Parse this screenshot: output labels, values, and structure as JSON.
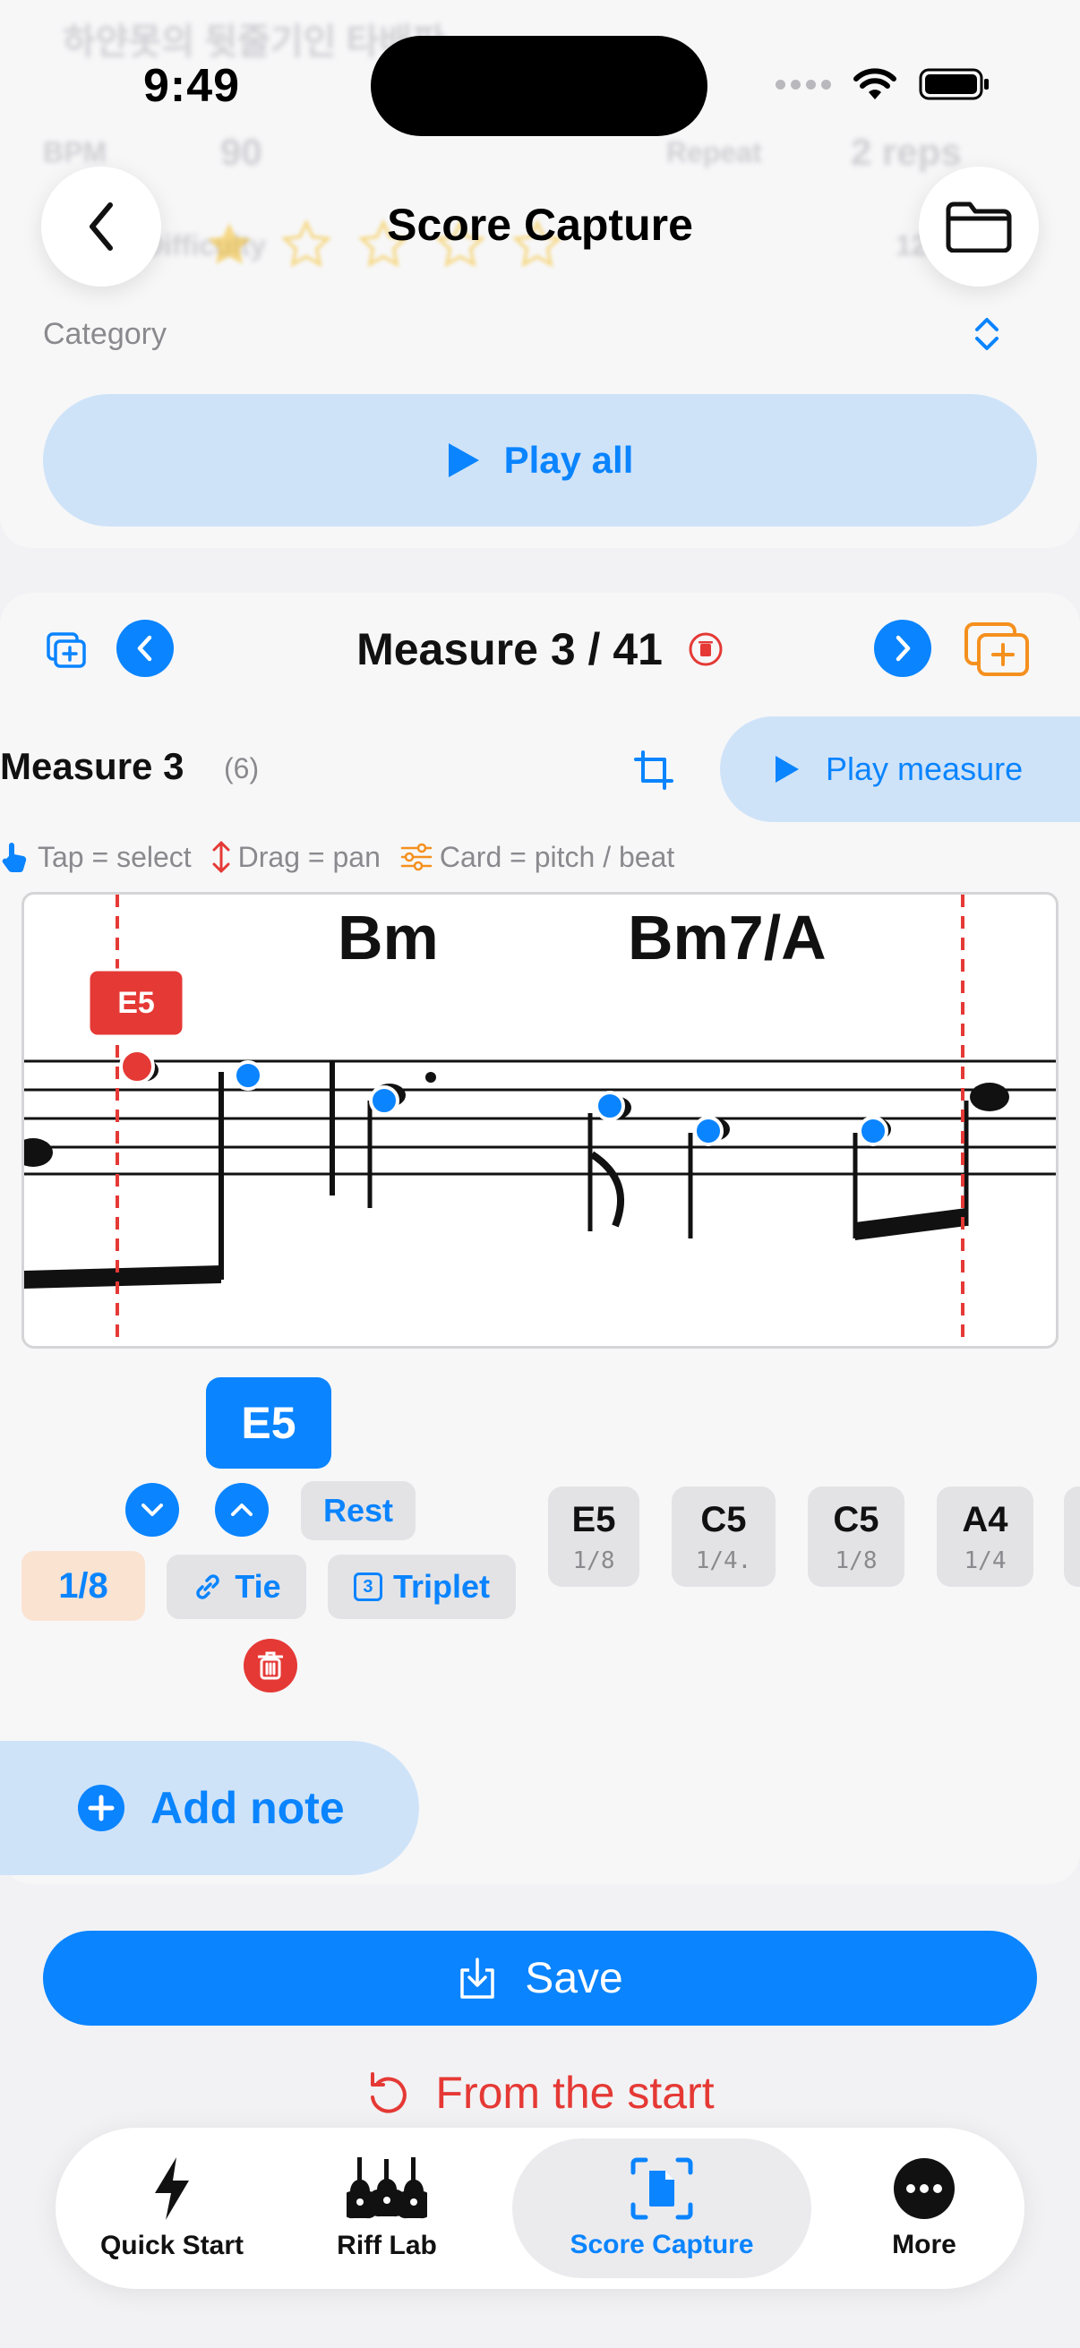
{
  "status_bar": {
    "time": "9:49"
  },
  "background_ghost": {
    "title": "하얀못의 뒷줄기인 타배판",
    "bpm_label": "BPM",
    "bpm_value": "90",
    "repeat_label": "Repeat",
    "repeat_value": "2 reps",
    "difficulty_label": "Difficulty",
    "right_value": "12"
  },
  "header": {
    "title": "Score Capture"
  },
  "top_card": {
    "category_label": "Category",
    "play_all_label": "Play all"
  },
  "measure_nav": {
    "title": "Measure 3 / 41"
  },
  "measure_detail": {
    "title": "Measure 3",
    "count": "(6)",
    "play_measure_label": "Play measure"
  },
  "hints": {
    "tap": "Tap = select",
    "drag": "Drag = pan",
    "card": "Card = pitch / beat"
  },
  "score": {
    "chord_1": "Bm",
    "chord_2": "Bm7/A",
    "selected_marker": "E5"
  },
  "editor": {
    "selected_note": "E5",
    "rest_label": "Rest",
    "duration": "1/8",
    "tie_label": "Tie",
    "triplet_label": "Triplet",
    "triplet_badge": "3",
    "notes": [
      {
        "pitch": "E5",
        "duration": "1/8"
      },
      {
        "pitch": "C5",
        "duration": "1/4."
      },
      {
        "pitch": "C5",
        "duration": "1/8"
      },
      {
        "pitch": "A4",
        "duration": "1/4"
      }
    ]
  },
  "add_note_label": "Add note",
  "save_label": "Save",
  "from_start_label": "From the start",
  "tabbar": {
    "items": [
      {
        "label": "Quick Start"
      },
      {
        "label": "Riff Lab"
      },
      {
        "label": "Score Capture"
      },
      {
        "label": "More"
      }
    ]
  },
  "colors": {
    "accent": "#0a84ff",
    "danger": "#e53935",
    "orange": "#f5901e",
    "accent_soft": "#cfe3f8"
  }
}
